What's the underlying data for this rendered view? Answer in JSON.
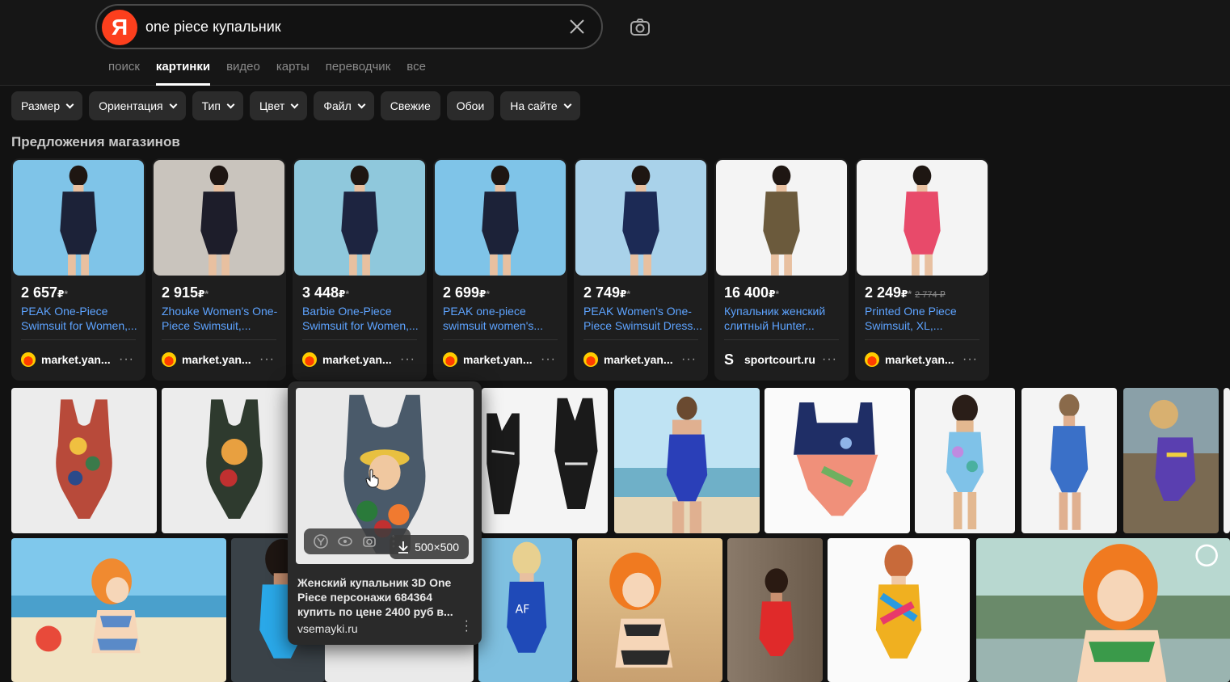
{
  "search": {
    "query": "one piece купальник",
    "logo_letter": "Я"
  },
  "tabs": [
    {
      "label": "поиск",
      "active": false
    },
    {
      "label": "картинки",
      "active": true
    },
    {
      "label": "видео",
      "active": false
    },
    {
      "label": "карты",
      "active": false
    },
    {
      "label": "переводчик",
      "active": false
    },
    {
      "label": "все",
      "active": false
    }
  ],
  "filters": [
    {
      "label": "Размер",
      "dropdown": true
    },
    {
      "label": "Ориентация",
      "dropdown": true
    },
    {
      "label": "Тип",
      "dropdown": true
    },
    {
      "label": "Цвет",
      "dropdown": true
    },
    {
      "label": "Файл",
      "dropdown": true
    },
    {
      "label": "Свежие",
      "dropdown": false
    },
    {
      "label": "Обои",
      "dropdown": false
    },
    {
      "label": "На сайте",
      "dropdown": true
    }
  ],
  "offers_title": "Предложения магазинов",
  "products": [
    {
      "price": "2 657",
      "currency": "₽",
      "old_price": "",
      "title": "PEAK One-Piece Swimsuit for Women,...",
      "shop": "market.yan...",
      "shop_icon": "market-icon",
      "bg": "#7fc4e8",
      "suit": "#1c2238"
    },
    {
      "price": "2 915",
      "currency": "₽",
      "old_price": "",
      "title": "Zhouke Women's One-Piece Swimsuit,...",
      "shop": "market.yan...",
      "shop_icon": "market-icon",
      "bg": "#c9c4bd",
      "suit": "#1d1d2a"
    },
    {
      "price": "3 448",
      "currency": "₽",
      "old_price": "",
      "title": "Barbie One-Piece Swimsuit for Women,...",
      "shop": "market.yan...",
      "shop_icon": "market-icon",
      "bg": "#8fc8dc",
      "suit": "#1d2440"
    },
    {
      "price": "2 699",
      "currency": "₽",
      "old_price": "",
      "title": "PEAK one-piece swimsuit women's...",
      "shop": "market.yan...",
      "shop_icon": "market-icon",
      "bg": "#7fc4e8",
      "suit": "#1c2238"
    },
    {
      "price": "2 749",
      "currency": "₽",
      "old_price": "",
      "title": "PEAK Women's One-Piece Swimsuit Dress...",
      "shop": "market.yan...",
      "shop_icon": "market-icon",
      "bg": "#a9d2ea",
      "suit": "#1c2a55"
    },
    {
      "price": "16 400",
      "currency": "₽",
      "old_price": "",
      "title": "Купальник женский слитный Hunter...",
      "shop": "sportcourt.ru",
      "shop_icon": "sportcourt-icon",
      "bg": "#f4f4f4",
      "suit": "#6b5a3c"
    },
    {
      "price": "2 249",
      "currency": "₽",
      "old_price": "2 774 ₽",
      "title": "Printed One Piece Swimsuit, XL,...",
      "shop": "market.yan...",
      "shop_icon": "market-icon",
      "bg": "#f4f4f4",
      "suit": "#e84a6a"
    }
  ],
  "popup": {
    "size": "500×500",
    "title": "Женский купальник 3D One Piece персонажи 684364 купить по цене 2400 руб в...",
    "domain": "vsemayki.ru"
  },
  "colors": {
    "accent_link": "#5da3ff",
    "yandex_red": "#fc3f1d",
    "bg": "#121212"
  }
}
